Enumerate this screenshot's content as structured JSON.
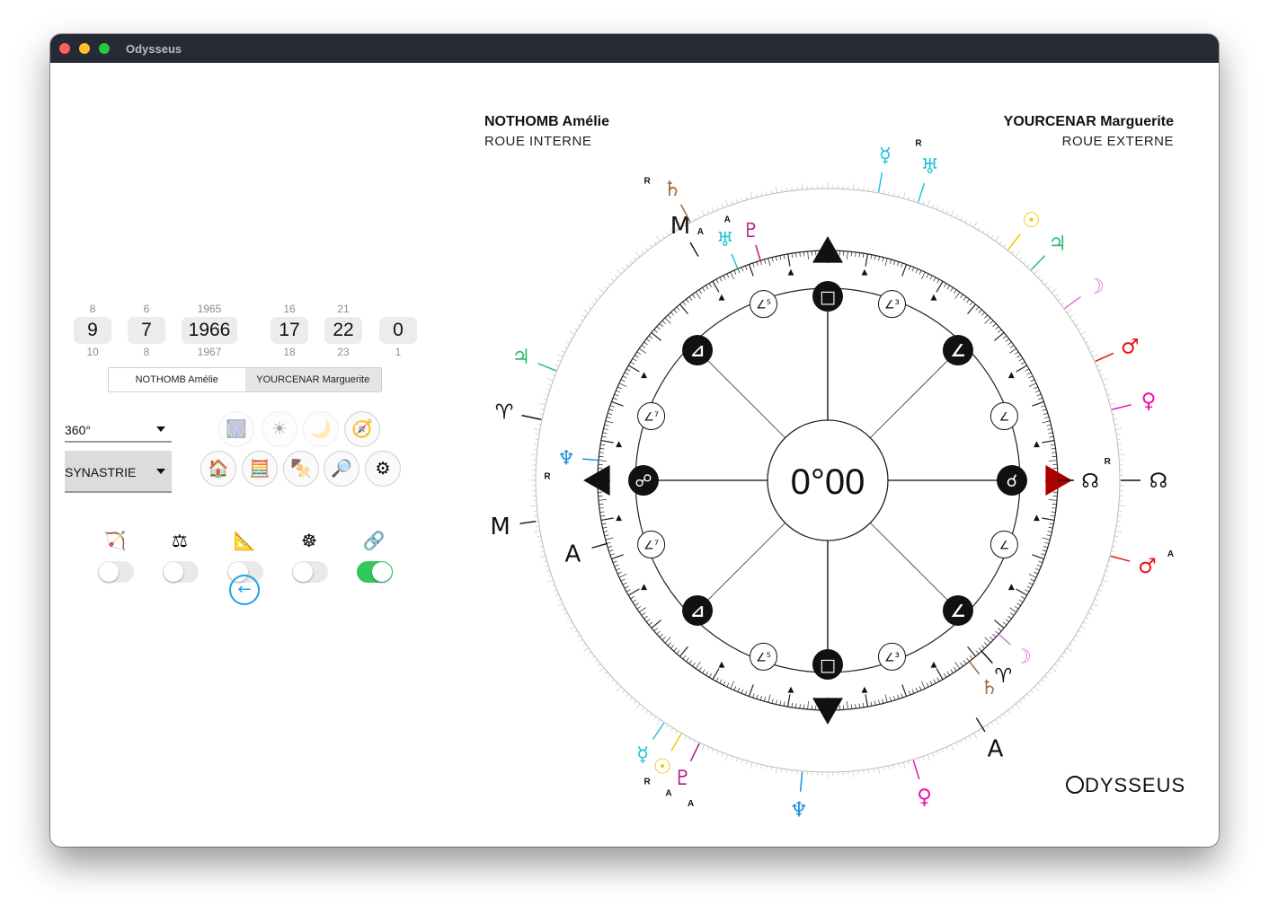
{
  "window": {
    "title": "Odysseus"
  },
  "pickers": [
    {
      "prev": "8",
      "current": "9",
      "next": "10"
    },
    {
      "prev": "6",
      "current": "7",
      "next": "8"
    },
    {
      "prev": "1965",
      "current": "1966",
      "next": "1967"
    },
    {
      "prev": "16",
      "current": "17",
      "next": "18"
    },
    {
      "prev": "21",
      "current": "22",
      "next": "23"
    },
    {
      "prev": "",
      "current": "0",
      "next": "1"
    }
  ],
  "person_tabs": {
    "a": "NOTHOMB Amélie",
    "b": "YOURCENAR Marguerite",
    "selected": "b"
  },
  "dropdowns": {
    "degrees": "360°",
    "mode": "SYNASTRIE"
  },
  "icon_buttons": [
    {
      "name": "fireworks-icon",
      "glyph": "🎆",
      "enabled": false
    },
    {
      "name": "sun-icon",
      "glyph": "☀",
      "enabled": false
    },
    {
      "name": "moon-icon",
      "glyph": "🌙",
      "enabled": false
    },
    {
      "name": "compass-icon",
      "glyph": "🧭",
      "enabled": true
    },
    {
      "name": "house-icon",
      "glyph": "🏠",
      "enabled": true
    },
    {
      "name": "abacus-icon",
      "glyph": "🧮",
      "enabled": true
    },
    {
      "name": "kebab-icon",
      "glyph": "🍢",
      "enabled": true
    },
    {
      "name": "magnifier-icon",
      "glyph": "🔎",
      "enabled": true
    },
    {
      "name": "gear-icon",
      "glyph": "⚙",
      "enabled": true
    }
  ],
  "toggles": [
    {
      "name": "bow-icon",
      "glyph": "🏹",
      "on": false
    },
    {
      "name": "scales-icon",
      "glyph": "⚖",
      "on": false
    },
    {
      "name": "triangle-ruler-icon",
      "glyph": "📐",
      "on": false
    },
    {
      "name": "wheel-icon",
      "glyph": "☸",
      "on": false
    },
    {
      "name": "link-icon",
      "glyph": "🔗",
      "on": true
    }
  ],
  "back_button": {
    "glyph": "←"
  },
  "chart": {
    "inner_name": "NOTHOMB Amélie",
    "inner_role": "ROUE INTERNE",
    "outer_name": "YOURCENAR Marguerite",
    "outer_role": "ROUE EXTERNE",
    "center_value": "0°00",
    "axis_labels": [
      {
        "text": "M",
        "angle": 120,
        "r": 328
      },
      {
        "text": "M",
        "angle": 188,
        "r": 368
      },
      {
        "text": "A",
        "angle": 196,
        "r": 295
      },
      {
        "text": "A",
        "angle": 302,
        "r": 352
      }
    ],
    "outer_planets": [
      {
        "glyph": "♅",
        "angle": 72,
        "color": "#22c4d6",
        "note": "R"
      },
      {
        "glyph": "☿",
        "angle": 80,
        "color": "#22c4d6",
        "note": ""
      },
      {
        "glyph": "☉",
        "angle": 52,
        "color": "#f0c800",
        "note": ""
      },
      {
        "glyph": "♃",
        "angle": 46,
        "color": "#2bbf73",
        "note": ""
      },
      {
        "glyph": "☽",
        "angle": 36,
        "color": "#d67ad6",
        "note": ""
      },
      {
        "glyph": "♂",
        "angle": 24,
        "color": "#ee1111",
        "note": ""
      },
      {
        "glyph": "♀",
        "angle": 14,
        "color": "#ee11aa",
        "note": ""
      },
      {
        "glyph": "☊",
        "angle": 0,
        "color": "#111111",
        "note": "R"
      },
      {
        "glyph": "♂",
        "angle": 345,
        "color": "#ee1111",
        "note": "A"
      },
      {
        "glyph": "♀",
        "angle": 287,
        "color": "#ee11aa",
        "note": ""
      },
      {
        "glyph": "♆",
        "angle": 265,
        "color": "#1b8fd6",
        "note": "A"
      },
      {
        "glyph": "♇",
        "angle": 244,
        "color": "#b5178f",
        "note": "A"
      },
      {
        "glyph": "☉",
        "angle": 240,
        "color": "#f0c800",
        "note": "A"
      },
      {
        "glyph": "☿",
        "angle": 236,
        "color": "#22c4d6",
        "note": "R"
      },
      {
        "glyph": "♈",
        "angle": 168,
        "color": "#111111",
        "note": ""
      },
      {
        "glyph": "♃",
        "angle": 158,
        "color": "#2bbf73",
        "note": ""
      },
      {
        "glyph": "♄",
        "angle": 118,
        "color": "#a06a3a",
        "note": "R"
      }
    ],
    "inner_planets": [
      {
        "glyph": "♇",
        "angle": 107,
        "color": "#b5178f",
        "note": "A"
      },
      {
        "glyph": "♅",
        "angle": 113,
        "color": "#22c4d6",
        "note": "A"
      },
      {
        "glyph": "♆",
        "angle": 175,
        "color": "#1b8fd6",
        "note": "R"
      },
      {
        "glyph": "☊",
        "angle": 0,
        "color": "#111111",
        "note": "R"
      },
      {
        "glyph": "☽",
        "angle": 318,
        "color": "#d67ad6",
        "note": ""
      },
      {
        "glyph": "♈",
        "angle": 312,
        "color": "#111111",
        "note": ""
      },
      {
        "glyph": "♄",
        "angle": 308,
        "color": "#a06a3a",
        "note": ""
      }
    ],
    "aspect_markers": [
      {
        "angle": 0,
        "glyph": "☌",
        "style": "filled",
        "color": "#111111"
      },
      {
        "angle": 45,
        "glyph": "∠",
        "style": "filled",
        "color": "#111111"
      },
      {
        "angle": 90,
        "glyph": "□",
        "style": "filled",
        "color": "#111111"
      },
      {
        "angle": 135,
        "glyph": "⊿",
        "style": "filled",
        "color": "#111111"
      },
      {
        "angle": 180,
        "glyph": "☍",
        "style": "filled",
        "color": "#111111"
      },
      {
        "angle": 225,
        "glyph": "⊿",
        "style": "filled",
        "color": "#111111"
      },
      {
        "angle": 270,
        "glyph": "□",
        "style": "filled",
        "color": "#111111"
      },
      {
        "angle": 315,
        "glyph": "∠",
        "style": "filled",
        "color": "#111111"
      },
      {
        "angle": 20,
        "glyph": "∠",
        "style": "outline",
        "color": "#111111"
      },
      {
        "angle": 70,
        "glyph": "∠³",
        "style": "outline",
        "color": "#111111"
      },
      {
        "angle": 110,
        "glyph": "∠⁵",
        "style": "outline",
        "color": "#111111"
      },
      {
        "angle": 160,
        "glyph": "∠⁷",
        "style": "outline",
        "color": "#111111"
      },
      {
        "angle": 200,
        "glyph": "∠⁷",
        "style": "outline",
        "color": "#111111"
      },
      {
        "angle": 250,
        "glyph": "∠⁵",
        "style": "outline",
        "color": "#111111"
      },
      {
        "angle": 290,
        "glyph": "∠³",
        "style": "outline",
        "color": "#111111"
      },
      {
        "angle": 340,
        "glyph": "∠",
        "style": "outline",
        "color": "#111111"
      }
    ],
    "highlight_color": "#aa0000"
  },
  "logo": {
    "text": "DYSSEUS"
  }
}
